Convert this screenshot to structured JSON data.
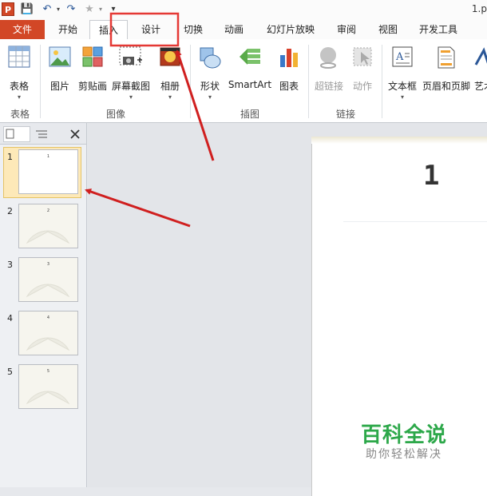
{
  "app": {
    "logo_letter": "P",
    "title_fragment": "1.p"
  },
  "quick_access": {
    "save": "💾",
    "undo": "↶",
    "redo": "↷",
    "star": "★",
    "customize": "▾"
  },
  "tabs": [
    "文件",
    "开始",
    "插入",
    "设计",
    "切换",
    "动画",
    "幻灯片放映",
    "审阅",
    "视图",
    "开发工具"
  ],
  "active_tab": "插入",
  "ribbon": {
    "groups": [
      {
        "name": "表格",
        "buttons": [
          "表格"
        ]
      },
      {
        "name": "图像",
        "buttons": [
          "图片",
          "剪贴画",
          "屏幕截图",
          "相册"
        ]
      },
      {
        "name": "插图",
        "buttons": [
          "形状",
          "SmartArt",
          "图表"
        ]
      },
      {
        "name": "链接",
        "buttons": [
          "超链接",
          "动作"
        ]
      },
      {
        "name": "",
        "buttons": [
          "文本框",
          "页眉和页脚",
          "艺术"
        ]
      }
    ]
  },
  "slides": [
    {
      "num": "1",
      "title": "1"
    },
    {
      "num": "2",
      "title": "2"
    },
    {
      "num": "3",
      "title": "3"
    },
    {
      "num": "4",
      "title": "4"
    },
    {
      "num": "5",
      "title": "5"
    }
  ],
  "selected_slide": 1,
  "slide_content": {
    "title": "1"
  },
  "watermark": {
    "brand": "百科全说",
    "slogan": "助你轻松解决"
  },
  "colors": {
    "file_tab": "#d24726",
    "highlight_box": "#e53935",
    "arrow": "#d01f1f",
    "watermark_green": "#2da84a"
  }
}
